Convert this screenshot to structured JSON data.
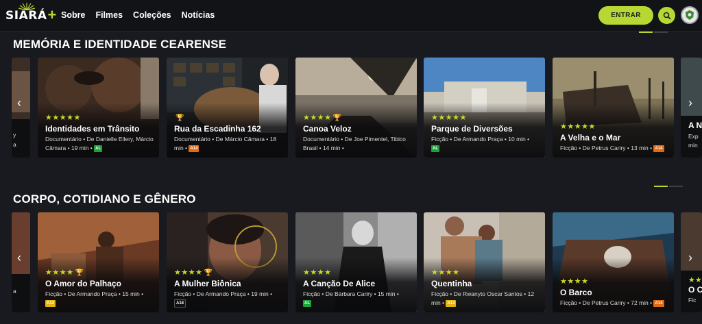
{
  "header": {
    "logo": "SIARÁ",
    "nav": [
      "Sobre",
      "Filmes",
      "Coleções",
      "Notícias"
    ],
    "login_label": "ENTRAR",
    "search_icon": "search-icon",
    "avatar_icon": "ceara-seal-icon"
  },
  "colors": {
    "accent": "#b7d732",
    "background": "#181a1f"
  },
  "sections": [
    {
      "title": "MEMÓRIA E IDENTIDADE CEARENSE",
      "left_partial": {
        "meta": "y",
        "meta2": "a"
      },
      "right_partial": {
        "title": "A N",
        "meta": "Exp",
        "meta2": "min"
      },
      "cards": [
        {
          "stars": "★★★★★",
          "trophy": false,
          "title": "Identidades em Trânsito",
          "meta": "Documentário • De Danielle Ellery, Márcio Câmara • 19 min •",
          "rating": "AL"
        },
        {
          "stars": "",
          "trophy": true,
          "title": "Rua da Escadinha 162",
          "meta": "Documentário • De Márcio Câmara • 18 min •",
          "rating": "A14"
        },
        {
          "stars": "★★★★",
          "trophy": true,
          "title": "Canoa Veloz",
          "meta": "Documentário • De Joe Pimentel, Tibico Brasil • 14 min •",
          "rating": ""
        },
        {
          "stars": "★★★★★",
          "trophy": false,
          "title": "Parque de Diversões",
          "meta": "Ficção • De Armando Praça • 10 min •",
          "rating": "AL"
        },
        {
          "stars": "★★★★★",
          "trophy": false,
          "title": "A Velha e o Mar",
          "meta": "Ficção • De Petrus Cariry • 13 min •",
          "rating": "A14"
        }
      ]
    },
    {
      "title": "CORPO, COTIDIANO E GÊNERO",
      "left_partial": {
        "meta": "a"
      },
      "right_partial": {
        "title": "O C",
        "meta": "Fic",
        "stars": "★★"
      },
      "cards": [
        {
          "stars": "★★★★",
          "trophy": true,
          "title": "O Amor do Palhaço",
          "meta": "Ficção • De Armando Praça • 15 min •",
          "rating": "A12"
        },
        {
          "stars": "★★★★",
          "trophy": true,
          "title": "A Mulher Biônica",
          "meta": "Ficção • De Armando Praça • 19 min •",
          "rating": "A18"
        },
        {
          "stars": "★★★★",
          "trophy": false,
          "title": "A Canção De Alice",
          "meta": "Ficção • De Bárbara Cariry • 15 min •",
          "rating": "AL"
        },
        {
          "stars": "★★★★",
          "trophy": false,
          "title": "Quentinha",
          "meta": "Ficção • De Rwanyto Oscar Santos • 12 min •",
          "rating": "A12"
        },
        {
          "stars": "★★★★",
          "trophy": false,
          "title": "O Barco",
          "meta": "Ficção • De Petrus Cariry • 72 min •",
          "rating": "A14"
        }
      ]
    }
  ]
}
